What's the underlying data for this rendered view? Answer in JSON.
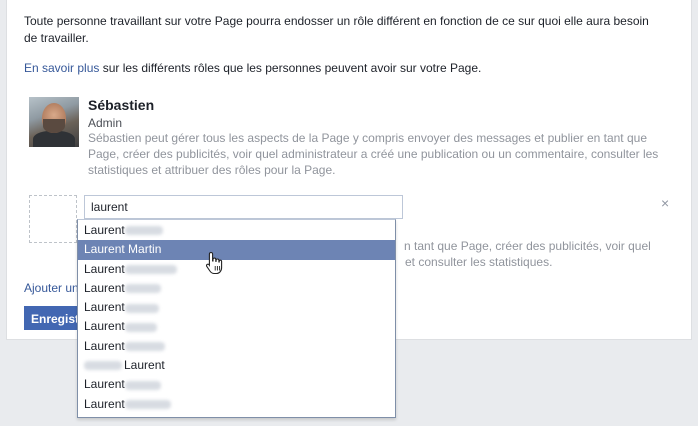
{
  "intro": {
    "line1": "Toute personne travaillant sur votre Page pourra endosser un rôle différent en fonction de ce sur quoi elle aura besoin",
    "line2": "de travailler."
  },
  "learn_more": {
    "link": "En savoir plus",
    "rest": " sur les différents rôles que les personnes peuvent avoir sur votre Page."
  },
  "admin": {
    "name": "Sébastien",
    "role": "Admin",
    "description": "Sébastien peut gérer tous les aspects de la Page y compris envoyer des messages et publier en tant que Page, créer des publicités, voir quel administrateur a créé une publication ou un commentaire, consulter les statistiques et attribuer des rôles pour la Page."
  },
  "new_role": {
    "search_value": "laurent",
    "close": "×",
    "description_line1": "n tant que Page, créer des publicités, voir quel",
    "description_line2": "et consulter les statistiques."
  },
  "add_link": "Ajouter une",
  "save_button": "Enregistrer",
  "dropdown": {
    "items": [
      {
        "first": "Laurent",
        "blurred": "after",
        "active": false
      },
      {
        "first": "Laurent Martin",
        "blurred": "none",
        "active": true
      },
      {
        "first": "Laurent",
        "blurred": "after",
        "active": false
      },
      {
        "first": "Laurent",
        "blurred": "after",
        "active": false
      },
      {
        "first": "Laurent",
        "blurred": "after",
        "active": false
      },
      {
        "first": "Laurent",
        "blurred": "after",
        "active": false
      },
      {
        "first": "Laurent",
        "blurred": "after",
        "active": false
      },
      {
        "first": "Laurent",
        "blurred": "before",
        "active": false
      },
      {
        "first": "Laurent",
        "blurred": "after",
        "active": false
      },
      {
        "first": "Laurent",
        "blurred": "after",
        "active": false
      }
    ]
  },
  "colors": {
    "link": "#365899",
    "button": "#4267b2",
    "highlight": "#6d84b4"
  }
}
